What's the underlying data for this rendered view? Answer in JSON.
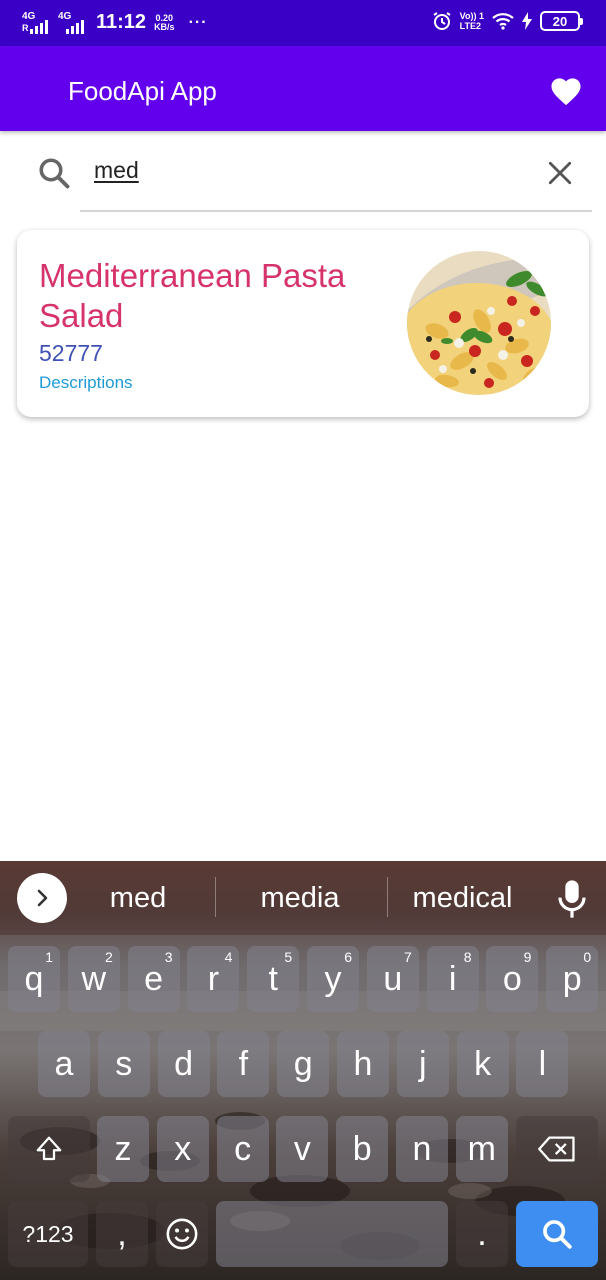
{
  "status_bar": {
    "net1": "4G",
    "net1_sub": "R",
    "net2": "4G",
    "time": "11:12",
    "speed_value": "0.20",
    "speed_unit": "KB/s",
    "overflow": "···",
    "volte_top": "Vo)) 1",
    "volte_bottom": "LTE2",
    "battery": "20"
  },
  "app_bar": {
    "title": "FoodApi App",
    "action_icon": "heart-icon"
  },
  "search": {
    "query": "med",
    "search_icon": "search-icon",
    "clear_icon": "close-icon"
  },
  "results": [
    {
      "title": "Mediterranean Pasta Salad",
      "id": "52777",
      "link": "Descriptions"
    }
  ],
  "keyboard": {
    "suggestions": [
      "med",
      "media",
      "medical"
    ],
    "row1": [
      {
        "k": "q",
        "h": "1"
      },
      {
        "k": "w",
        "h": "2"
      },
      {
        "k": "e",
        "h": "3"
      },
      {
        "k": "r",
        "h": "4"
      },
      {
        "k": "t",
        "h": "5"
      },
      {
        "k": "y",
        "h": "6"
      },
      {
        "k": "u",
        "h": "7"
      },
      {
        "k": "i",
        "h": "8"
      },
      {
        "k": "o",
        "h": "9"
      },
      {
        "k": "p",
        "h": "0"
      }
    ],
    "row2": [
      "a",
      "s",
      "d",
      "f",
      "g",
      "h",
      "j",
      "k",
      "l"
    ],
    "row3": [
      "z",
      "x",
      "c",
      "v",
      "b",
      "n",
      "m"
    ],
    "symbols_label": "?123",
    "comma": ",",
    "period": "."
  },
  "colors": {
    "status_bar": "#3b00c6",
    "app_bar": "#6200ee",
    "title_pink": "#d6336c",
    "id_blue": "#3f51b5",
    "link_blue": "#1e9bd7",
    "search_key": "#3d8ef0"
  }
}
